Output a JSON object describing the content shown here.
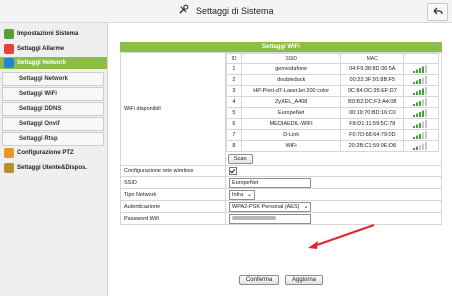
{
  "header": {
    "title": "Settaggi di Sistema"
  },
  "sidebar": {
    "items": [
      {
        "label": "Impostazioni Sistema",
        "color": "#5a9e33"
      },
      {
        "label": "Settaggi Allarme",
        "color": "#e0433a"
      },
      {
        "label": "Settaggi Network",
        "color": "#1f86d6"
      }
    ],
    "subitems": [
      {
        "label": "Settaggi Network"
      },
      {
        "label": "Settaggi WiFi"
      },
      {
        "label": "Settaggi DDNS"
      },
      {
        "label": "Settaggi Onvif"
      },
      {
        "label": "Settaggi Rtsp"
      }
    ],
    "items2": [
      {
        "label": "Configurazione PTZ",
        "color": "#e39a2a"
      },
      {
        "label": "Settaggi Utente&Dispos.",
        "color": "#b58f2a"
      }
    ]
  },
  "panel": {
    "title": "Settaggi WiFi",
    "wifi_label": "WiFi disponibili",
    "columns": [
      "ID",
      "SSID",
      "MAC"
    ],
    "networks": [
      {
        "id": "1",
        "ssid": "genvodafone",
        "mac": "04:F9:38:8D:36:5A",
        "bars": 4
      },
      {
        "id": "2",
        "ssid": "doubleduck",
        "mac": "00:22:3F:91:8B:F5",
        "bars": 3
      },
      {
        "id": "3",
        "ssid": "HP-Print-d7-LaserJet 200 color",
        "mac": "0C:84:DC:95:EF:D7",
        "bars": 4
      },
      {
        "id": "4",
        "ssid": "ZyXEL_A408",
        "mac": "B0:B2:DC:F3:A4:08",
        "bars": 3
      },
      {
        "id": "5",
        "ssid": "EuropeNet",
        "mac": "00:19:70:BD:16:C0",
        "bars": 4
      },
      {
        "id": "6",
        "ssid": "MEDIAEDIL-WIFI",
        "mac": "F8:D1:11:59:5C:78",
        "bars": 3
      },
      {
        "id": "7",
        "ssid": "D-Link",
        "mac": "F0:7D:68:64:79:0D",
        "bars": 3
      },
      {
        "id": "8",
        "ssid": "WiFi",
        "mac": "20:2B:C1:59:9E:D8",
        "bars": 2
      }
    ],
    "scan_label": "Scan",
    "config_label": "Configurazione rete wireless",
    "ssid_label": "SSID",
    "ssid_value": "EuropeNet",
    "tipo_label": "Tipo Network",
    "tipo_value": "Infra",
    "auth_label": "Autenticazione",
    "auth_value": "WPA2-PSK Personal (AES)",
    "pwd_label": "Password Wifi",
    "confirm_label": "Conferma",
    "refresh_label": "Aggiorna"
  },
  "colors": {
    "accent": "#8bbd47",
    "arrow": "#e0262b"
  }
}
